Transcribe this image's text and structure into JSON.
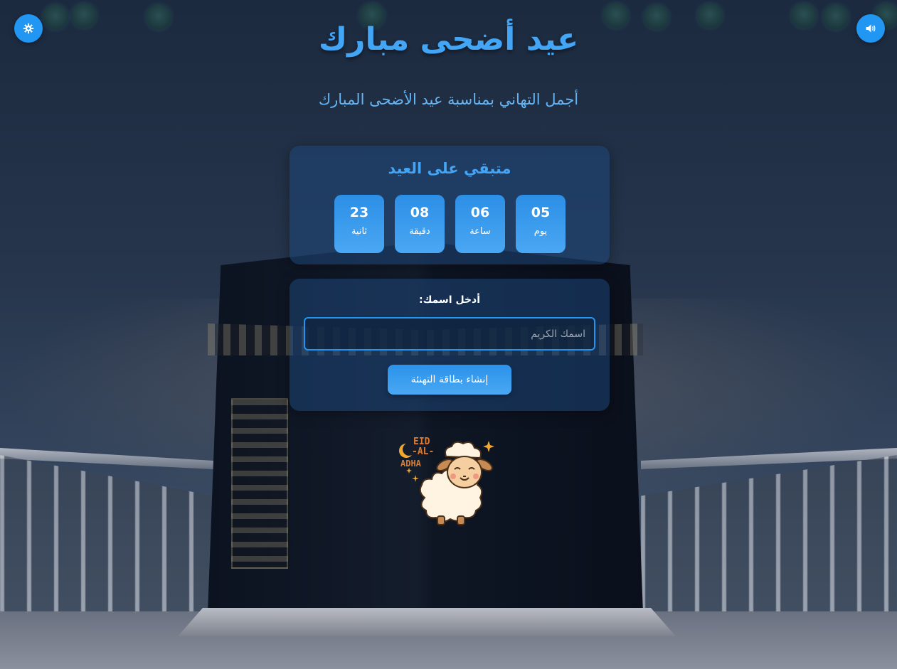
{
  "header": {
    "title": "عيد أضحى مبارك",
    "subtitle": "أجمل التهاني بمناسبة عيد الأضحى المبارك"
  },
  "controls": {
    "theme_icon": "gear-icon",
    "sound_icon": "volume-icon"
  },
  "countdown": {
    "title": "متبقي على العيد",
    "units": [
      {
        "value": "05",
        "label": "يوم"
      },
      {
        "value": "06",
        "label": "ساعة"
      },
      {
        "value": "08",
        "label": "دقيقة"
      },
      {
        "value": "23",
        "label": "ثانية"
      }
    ]
  },
  "form": {
    "label": "أدخل اسمك:",
    "name_value": "",
    "name_placeholder": "اسمك الكريم",
    "submit_label": "إنشاء بطاقة التهنئة"
  },
  "mascot": {
    "text_lines": [
      "EID",
      "-AL-",
      "ADHA"
    ]
  },
  "colors": {
    "accent": "#2196f3",
    "title": "#42a5f5",
    "subtitle": "#64b5f6"
  }
}
